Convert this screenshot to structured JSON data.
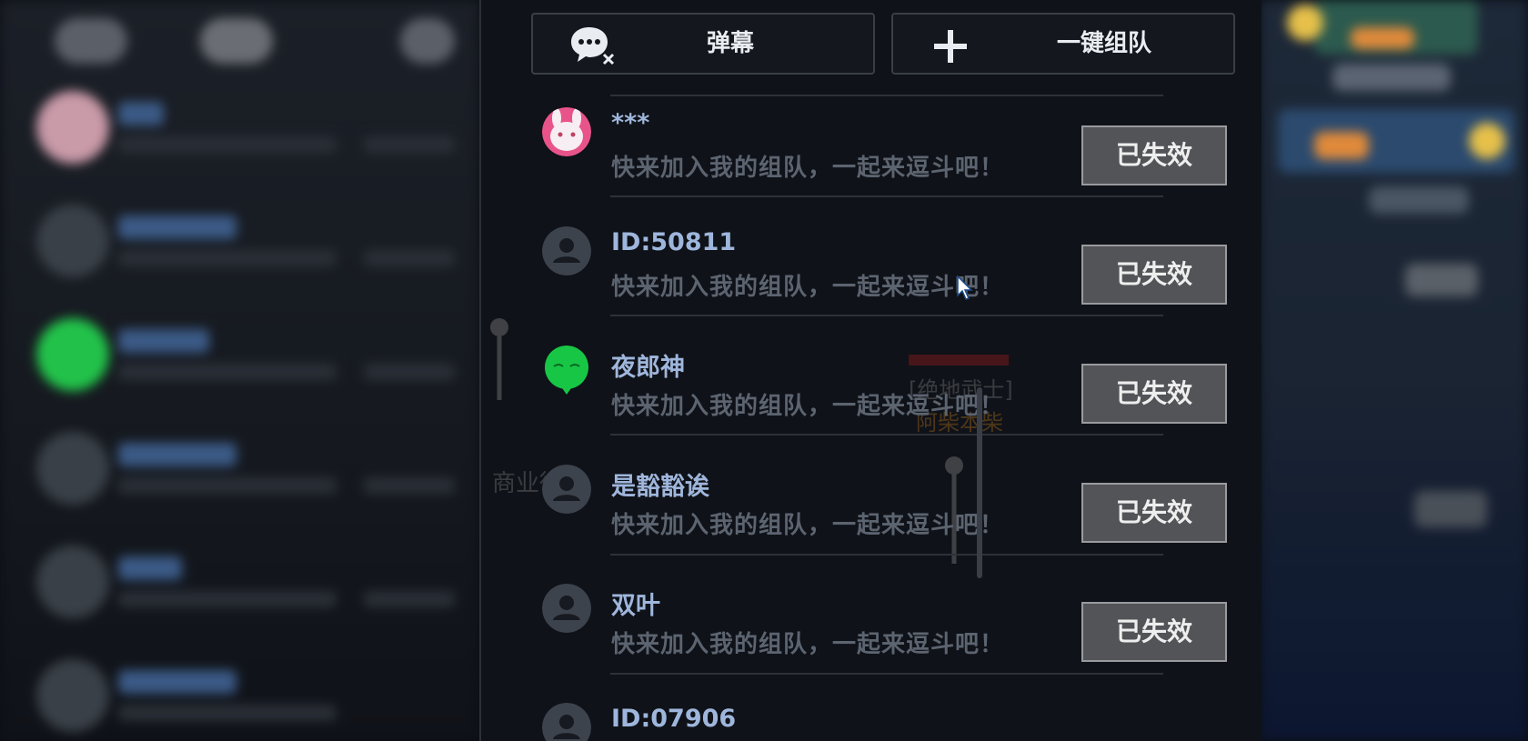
{
  "toolbar": {
    "barrage_label": "弹幕",
    "team_label": "一键组队"
  },
  "invites": [
    {
      "name": "***",
      "message": "快来加入我的组队，一起来逗斗吧！",
      "status": "已失效",
      "avatar": "rabbit"
    },
    {
      "name": "ID:50811",
      "message": "快来加入我的组队，一起来逗斗吧！",
      "status": "已失效",
      "avatar": "default"
    },
    {
      "name": "夜郎神",
      "message": "快来加入我的组队，一起来逗斗吧！",
      "status": "已失效",
      "avatar": "green"
    },
    {
      "name": "是豁豁诶",
      "message": "快来加入我的组队，一起来逗斗吧！",
      "status": "已失效",
      "avatar": "default"
    },
    {
      "name": "双叶",
      "message": "快来加入我的组队，一起来逗斗吧！",
      "status": "已失效",
      "avatar": "default"
    },
    {
      "name": "ID:07906",
      "message": "",
      "status": "",
      "avatar": "default"
    }
  ],
  "colors": {
    "name": "#9fb6dc",
    "message": "#5c6470",
    "button_bg": "#535458"
  },
  "icons": {
    "barrage": "chat-bubble-off-icon",
    "team": "plus-icon",
    "default_avatar": "user-silhouette-icon"
  }
}
